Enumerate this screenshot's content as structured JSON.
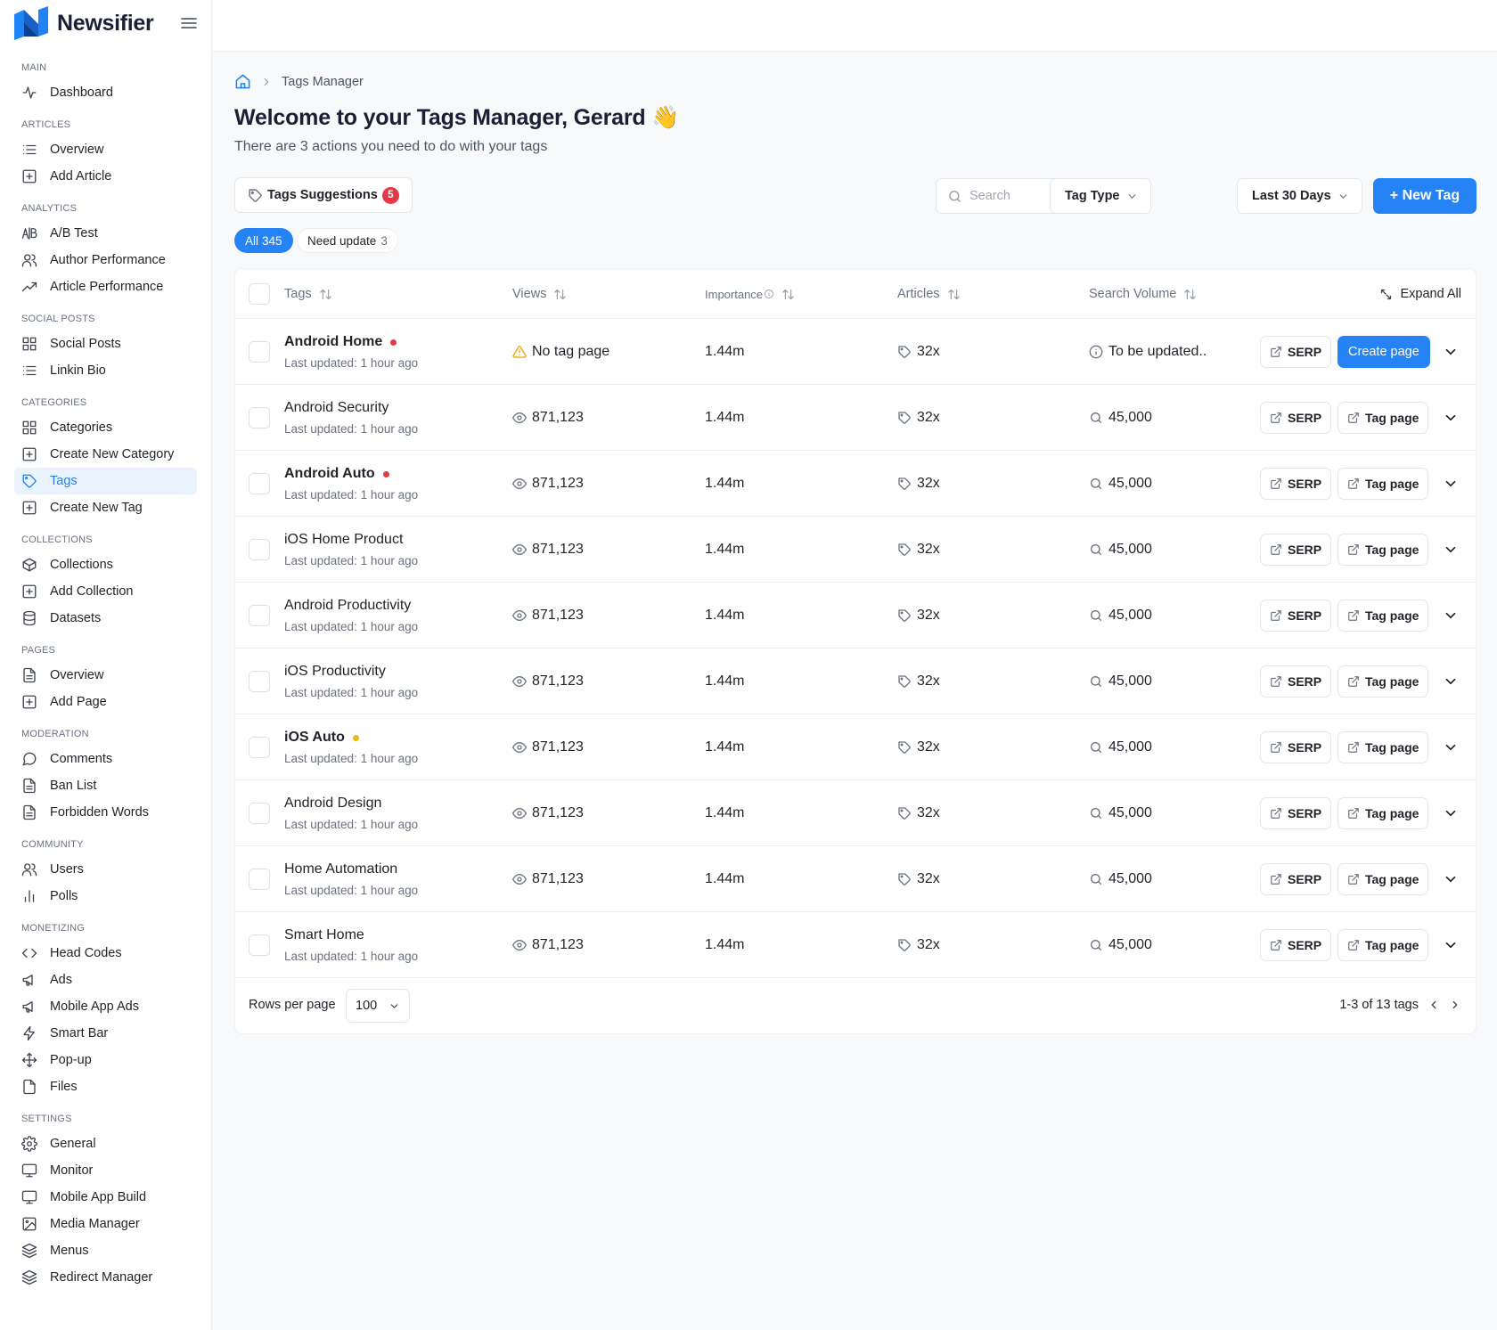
{
  "brand": {
    "name": "Newsifier"
  },
  "sidebar": {
    "sections": [
      {
        "title": "MAIN",
        "items": [
          {
            "label": "Dashboard",
            "icon": "activity-icon"
          }
        ]
      },
      {
        "title": "ARTICLES",
        "items": [
          {
            "label": "Overview",
            "icon": "list-icon"
          },
          {
            "label": "Add Article",
            "icon": "plus-square-icon"
          }
        ]
      },
      {
        "title": "ANALYTICS",
        "items": [
          {
            "label": "A/B Test",
            "icon": "ab-test-icon"
          },
          {
            "label": "Author Performance",
            "icon": "users-icon"
          },
          {
            "label": "Article Performance",
            "icon": "trending-up-icon"
          }
        ]
      },
      {
        "title": "SOCIAL POSTS",
        "items": [
          {
            "label": "Social Posts",
            "icon": "grid-icon"
          },
          {
            "label": "Linkin Bio",
            "icon": "list-icon"
          }
        ]
      },
      {
        "title": "CATEGORIES",
        "items": [
          {
            "label": "Categories",
            "icon": "grid-icon"
          },
          {
            "label": "Create New Category",
            "icon": "plus-square-icon"
          },
          {
            "label": "Tags",
            "icon": "tag-icon",
            "active": true
          },
          {
            "label": "Create New Tag",
            "icon": "plus-square-icon"
          }
        ]
      },
      {
        "title": "COLLECTIONS",
        "items": [
          {
            "label": "Collections",
            "icon": "box-icon"
          },
          {
            "label": "Add Collection",
            "icon": "plus-square-icon"
          },
          {
            "label": "Datasets",
            "icon": "database-icon"
          }
        ]
      },
      {
        "title": "PAGES",
        "items": [
          {
            "label": "Overview",
            "icon": "file-text-icon"
          },
          {
            "label": "Add Page",
            "icon": "plus-square-icon"
          }
        ]
      },
      {
        "title": "MODERATION",
        "items": [
          {
            "label": "Comments",
            "icon": "message-circle-icon"
          },
          {
            "label": "Ban List",
            "icon": "file-text-icon"
          },
          {
            "label": "Forbidden Words",
            "icon": "file-text-icon"
          }
        ]
      },
      {
        "title": "COMMUNITY",
        "items": [
          {
            "label": "Users",
            "icon": "users-icon"
          },
          {
            "label": "Polls",
            "icon": "bar-chart-icon"
          }
        ]
      },
      {
        "title": "MONETIZING",
        "items": [
          {
            "label": "Head Codes",
            "icon": "code-icon"
          },
          {
            "label": "Ads",
            "icon": "megaphone-icon"
          },
          {
            "label": "Mobile App Ads",
            "icon": "megaphone-icon"
          },
          {
            "label": "Smart Bar",
            "icon": "zap-icon"
          },
          {
            "label": "Pop-up",
            "icon": "move-icon"
          },
          {
            "label": "Files",
            "icon": "file-icon"
          }
        ]
      },
      {
        "title": "SETTINGS",
        "items": [
          {
            "label": "General",
            "icon": "settings-icon"
          },
          {
            "label": "Monitor",
            "icon": "monitor-icon"
          },
          {
            "label": "Mobile App Build",
            "icon": "monitor-icon"
          },
          {
            "label": "Media Manager",
            "icon": "image-icon"
          },
          {
            "label": "Menus",
            "icon": "layers-icon"
          },
          {
            "label": "Redirect Manager",
            "icon": "layers-icon"
          }
        ]
      }
    ]
  },
  "breadcrumb": {
    "current": "Tags Manager"
  },
  "header": {
    "title": "Welcome to your Tags Manager, Gerard 👋",
    "subtitle": "There are 3 actions you need to do with your tags"
  },
  "toolbar": {
    "suggestions_label": "Tags Suggestions",
    "suggestions_count": "5",
    "search_placeholder": "Search",
    "tag_type_label": "Tag Type",
    "date_range_label": "Last 30 Days",
    "new_tag_label": "+ New Tag"
  },
  "filters": {
    "all_label": "All",
    "all_count": "345",
    "need_update_label": "Need update",
    "need_update_count": "3"
  },
  "table": {
    "headers": {
      "tags": "Tags",
      "views": "Views",
      "importance": "Importance",
      "articles": "Articles",
      "search_volume": "Search Volume",
      "expand_all": "Expand All"
    },
    "rows": [
      {
        "name": "Android Home",
        "bold": true,
        "status_dot": "#e63946",
        "updated": "Last updated: 1 hour ago",
        "views": "No tag page",
        "views_icon": "warning-icon",
        "importance": "1.44m",
        "articles": "32x",
        "search_volume": "To be updated..",
        "sv_icon": "info-icon",
        "serp_label": "SERP",
        "action_label": "Create page",
        "action_primary": true
      },
      {
        "name": "Android Security",
        "bold": false,
        "status_dot": "",
        "updated": "Last updated: 1 hour ago",
        "views": "871,123",
        "views_icon": "eye-icon",
        "importance": "1.44m",
        "articles": "32x",
        "search_volume": "45,000",
        "sv_icon": "search-icon",
        "serp_label": "SERP",
        "action_label": "Tag page",
        "action_primary": false
      },
      {
        "name": "Android Auto",
        "bold": true,
        "status_dot": "#e63946",
        "updated": "Last updated: 1 hour ago",
        "views": "871,123",
        "views_icon": "eye-icon",
        "importance": "1.44m",
        "articles": "32x",
        "search_volume": "45,000",
        "sv_icon": "search-icon",
        "serp_label": "SERP",
        "action_label": "Tag page",
        "action_primary": false
      },
      {
        "name": "iOS Home Product",
        "bold": false,
        "status_dot": "",
        "updated": "Last updated: 1 hour ago",
        "views": "871,123",
        "views_icon": "eye-icon",
        "importance": "1.44m",
        "articles": "32x",
        "search_volume": "45,000",
        "sv_icon": "search-icon",
        "serp_label": "SERP",
        "action_label": "Tag page",
        "action_primary": false
      },
      {
        "name": "Android Productivity",
        "bold": false,
        "status_dot": "",
        "updated": "Last updated: 1 hour ago",
        "views": "871,123",
        "views_icon": "eye-icon",
        "importance": "1.44m",
        "articles": "32x",
        "search_volume": "45,000",
        "sv_icon": "search-icon",
        "serp_label": "SERP",
        "action_label": "Tag page",
        "action_primary": false
      },
      {
        "name": "iOS Productivity",
        "bold": false,
        "status_dot": "",
        "updated": "Last updated: 1 hour ago",
        "views": "871,123",
        "views_icon": "eye-icon",
        "importance": "1.44m",
        "articles": "32x",
        "search_volume": "45,000",
        "sv_icon": "search-icon",
        "serp_label": "SERP",
        "action_label": "Tag page",
        "action_primary": false
      },
      {
        "name": "iOS Auto",
        "bold": true,
        "status_dot": "#f2b705",
        "updated": "Last updated: 1 hour ago",
        "views": "871,123",
        "views_icon": "eye-icon",
        "importance": "1.44m",
        "articles": "32x",
        "search_volume": "45,000",
        "sv_icon": "search-icon",
        "serp_label": "SERP",
        "action_label": "Tag page",
        "action_primary": false
      },
      {
        "name": "Android Design",
        "bold": false,
        "status_dot": "",
        "updated": "Last updated: 1 hour ago",
        "views": "871,123",
        "views_icon": "eye-icon",
        "importance": "1.44m",
        "articles": "32x",
        "search_volume": "45,000",
        "sv_icon": "search-icon",
        "serp_label": "SERP",
        "action_label": "Tag page",
        "action_primary": false
      },
      {
        "name": "Home Automation",
        "bold": false,
        "status_dot": "",
        "updated": "Last updated: 1 hour ago",
        "views": "871,123",
        "views_icon": "eye-icon",
        "importance": "1.44m",
        "articles": "32x",
        "search_volume": "45,000",
        "sv_icon": "search-icon",
        "serp_label": "SERP",
        "action_label": "Tag page",
        "action_primary": false
      },
      {
        "name": "Smart Home",
        "bold": false,
        "status_dot": "",
        "updated": "Last updated: 1 hour ago",
        "views": "871,123",
        "views_icon": "eye-icon",
        "importance": "1.44m",
        "articles": "32x",
        "search_volume": "45,000",
        "sv_icon": "search-icon",
        "serp_label": "SERP",
        "action_label": "Tag page",
        "action_primary": false
      }
    ]
  },
  "footer": {
    "rows_per_page_label": "Rows per page",
    "rows_per_page_value": "100",
    "pagination_text": "1-3 of 13 tags"
  },
  "colors": {
    "accent": "#2583f6",
    "active_nav_bg": "#eaf3fe",
    "badge_red": "#e63946",
    "warning": "#e8a800"
  }
}
